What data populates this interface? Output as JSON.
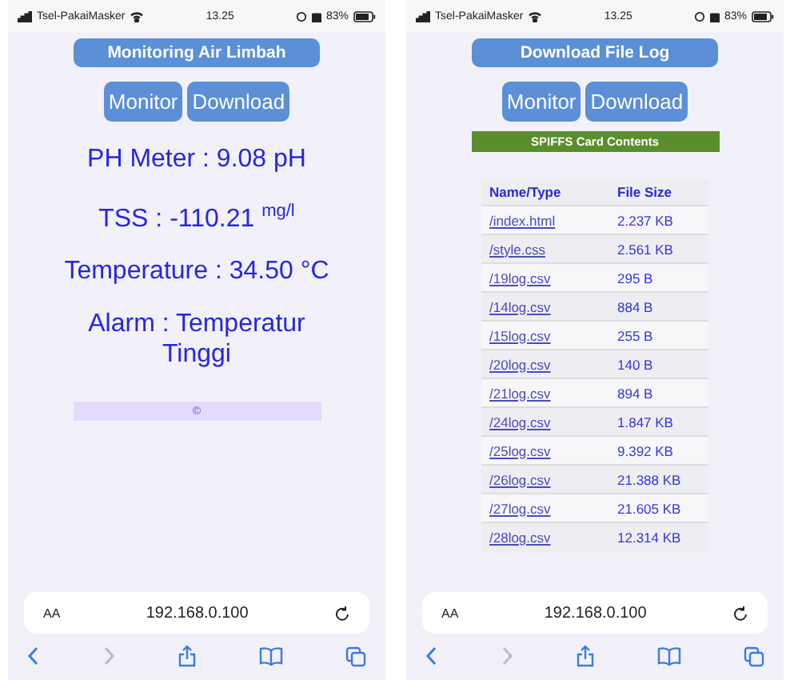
{
  "screens": [
    {
      "kind": "monitor",
      "status_bar": {
        "carrier": "Tsel-PakaiMasker",
        "time": "13.25",
        "battery": "83%"
      },
      "title": "Monitoring Air Limbah",
      "nav_buttons": [
        "Monitor",
        "Download"
      ],
      "readings": [
        "PH Meter : 9.08 pH",
        "TSS : -110.21 $^{mg/l}$",
        "Temperature : 34.50 °C",
        "Alarm : Temperatur Tinggi"
      ],
      "footer": "©",
      "address_bar": {
        "text_size": "AA",
        "url": "192.168.0.100"
      }
    },
    {
      "kind": "files",
      "status_bar": {
        "carrier": "Tsel-PakaiMasker",
        "time": "13.25",
        "battery": "83%"
      },
      "title": "Download File Log",
      "nav_buttons": [
        "Monitor",
        "Download"
      ],
      "banner": "SPIFFS Card Contents",
      "table": {
        "columns": [
          "Name/Type",
          "File Size"
        ],
        "rows": [
          [
            "/index.html",
            "2.237 KB"
          ],
          [
            "/style.css",
            "2.561 KB"
          ],
          [
            "/19log.csv",
            "295 B"
          ],
          [
            "/14log.csv",
            "884 B"
          ],
          [
            "/15log.csv",
            "255 B"
          ],
          [
            "/20log.csv",
            "140 B"
          ],
          [
            "/21log.csv",
            "894 B"
          ],
          [
            "/24log.csv",
            "1.847 KB"
          ],
          [
            "/25log.csv",
            "9.392 KB"
          ],
          [
            "/26log.csv",
            "21.388 KB"
          ],
          [
            "/27log.csv",
            "21.605 KB"
          ],
          [
            "/28log.csv",
            "12.314 KB"
          ]
        ]
      },
      "address_bar": {
        "text_size": "AA",
        "url": "192.168.0.100"
      }
    }
  ]
}
